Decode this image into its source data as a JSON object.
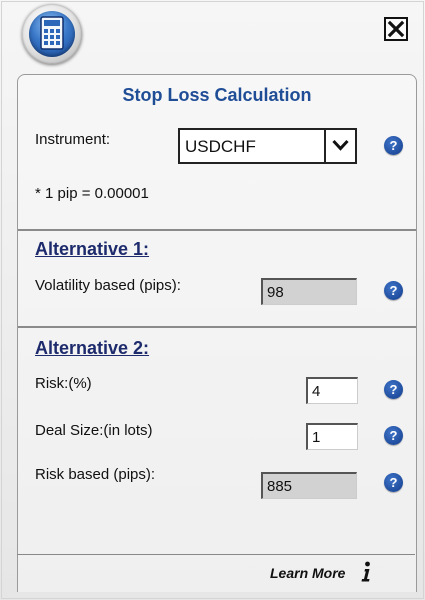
{
  "header": {
    "app_icon": "calculator-icon",
    "close_icon": "close-icon"
  },
  "panel": {
    "title": "Stop Loss Calculation",
    "instrument": {
      "label": "Instrument:",
      "selected": "USDCHF",
      "note": "* 1 pip = 0.00001"
    },
    "alternative1": {
      "title": "Alternative 1:",
      "volatility_label": "Volatility based (pips):",
      "volatility_value": "98"
    },
    "alternative2": {
      "title": "Alternative 2:",
      "risk_label": "Risk:(%)",
      "risk_value": "4",
      "deal_size_label": "Deal Size:(in lots)",
      "deal_size_value": "1",
      "risk_based_label": "Risk based (pips):",
      "risk_based_value": "885"
    },
    "help_glyph": "?"
  },
  "footer": {
    "learn_more": "Learn More",
    "info_icon": "info-icon"
  },
  "colors": {
    "title": "#1f4d96",
    "section_title": "#1d2a6c",
    "help_icon": "#1e4fa3",
    "readonly_field": "#d2d2d2"
  }
}
